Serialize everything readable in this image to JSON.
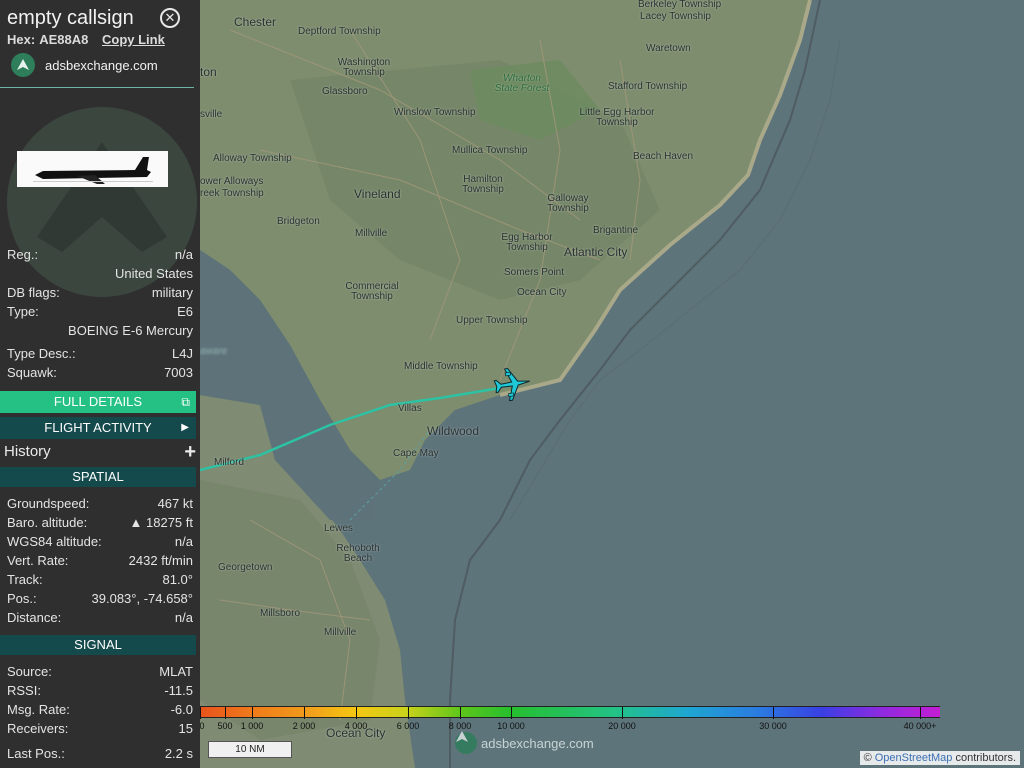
{
  "sidebar": {
    "callsign": "empty callsign",
    "hex_label": "Hex:",
    "hex_value": "AE88A8",
    "copy_link": "Copy Link",
    "brand": "adsbexchange.com",
    "info": {
      "reg_label": "Reg.:",
      "reg_value": "n/a",
      "country": "United States",
      "dbflags_label": "DB flags:",
      "dbflags_value": "military",
      "type_label": "Type:",
      "type_value": "E6",
      "type_name": "BOEING E-6 Mercury",
      "typedesc_label": "Type Desc.:",
      "typedesc_value": "L4J",
      "squawk_label": "Squawk:",
      "squawk_value": "7003"
    },
    "full_details": "FULL DETAILS",
    "flight_activity": "FLIGHT ACTIVITY",
    "history": "History",
    "spatial": {
      "title": "SPATIAL",
      "rows": [
        {
          "label": "Groundspeed:",
          "value": "467 kt"
        },
        {
          "label": "Baro. altitude:",
          "value": "▲ 18275 ft"
        },
        {
          "label": "WGS84 altitude:",
          "value": "n/a"
        },
        {
          "label": "Vert. Rate:",
          "value": "2432 ft/min"
        },
        {
          "label": "Track:",
          "value": "81.0°"
        },
        {
          "label": "Pos.:",
          "value": "39.083°, -74.658°"
        },
        {
          "label": "Distance:",
          "value": "n/a"
        }
      ]
    },
    "signal": {
      "title": "SIGNAL",
      "rows": [
        {
          "label": "Source:",
          "value": "MLAT"
        },
        {
          "label": "RSSI:",
          "value": "-11.5"
        },
        {
          "label": "Msg. Rate:",
          "value": "-6.0"
        },
        {
          "label": "Receivers:",
          "value": "15"
        },
        {
          "label": "Last Pos.:",
          "value": "2.2 s"
        }
      ]
    }
  },
  "map": {
    "labels": {
      "chester": "Chester",
      "deptford": "Deptford Township",
      "washington": "Washington Township",
      "glassboro": "Glassboro",
      "winslow": "Winslow Township",
      "wharton": "Wharton State Forest",
      "mullica": "Mullica Township",
      "hamilton": "Hamilton Township",
      "alloway": "Alloway Township",
      "lower_alloways": "ower Alloways",
      "reek": "reek Township",
      "vineland": "Vineland",
      "bridgeton": "Bridgeton",
      "millville": "Millville",
      "commercial": "Commercial Township",
      "egg_harbor": "Egg Harbor Township",
      "galloway": "Galloway Township",
      "brigantine": "Brigantine",
      "atlantic_city": "Atlantic City",
      "somers_point": "Somers Point",
      "ocean_city": "Ocean City",
      "upper": "Upper Township",
      "middle": "Middle Township",
      "villas": "Villas",
      "wildwood": "Wildwood",
      "cape_may": "Cape May",
      "milford": "Milford",
      "lewes": "Lewes",
      "rehoboth": "Rehoboth Beach",
      "georgetown": "Georgetown",
      "millsboro": "Millsboro",
      "millville_de": "Millville",
      "ocean_city_md": "Ocean City",
      "berkeley": "Berkeley Township",
      "lacey": "Lacey Township",
      "waretown": "Waretown",
      "stafford": "Stafford Township",
      "little_egg": "Little Egg Harbor Township",
      "beach_haven": "Beach Haven",
      "ton": "ton",
      "sville": "sville",
      "aware": "aware"
    },
    "altitude_legend": [
      "0",
      "500",
      "1 000",
      "2 000",
      "4 000",
      "6 000",
      "8 000",
      "10 000",
      "20 000",
      "30 000",
      "40 000+"
    ],
    "scale": "10 NM",
    "watermark": "adsbexchange.com",
    "attribution_prefix": "©",
    "attribution_link": "OpenStreetMap",
    "attribution_suffix": "contributors."
  }
}
